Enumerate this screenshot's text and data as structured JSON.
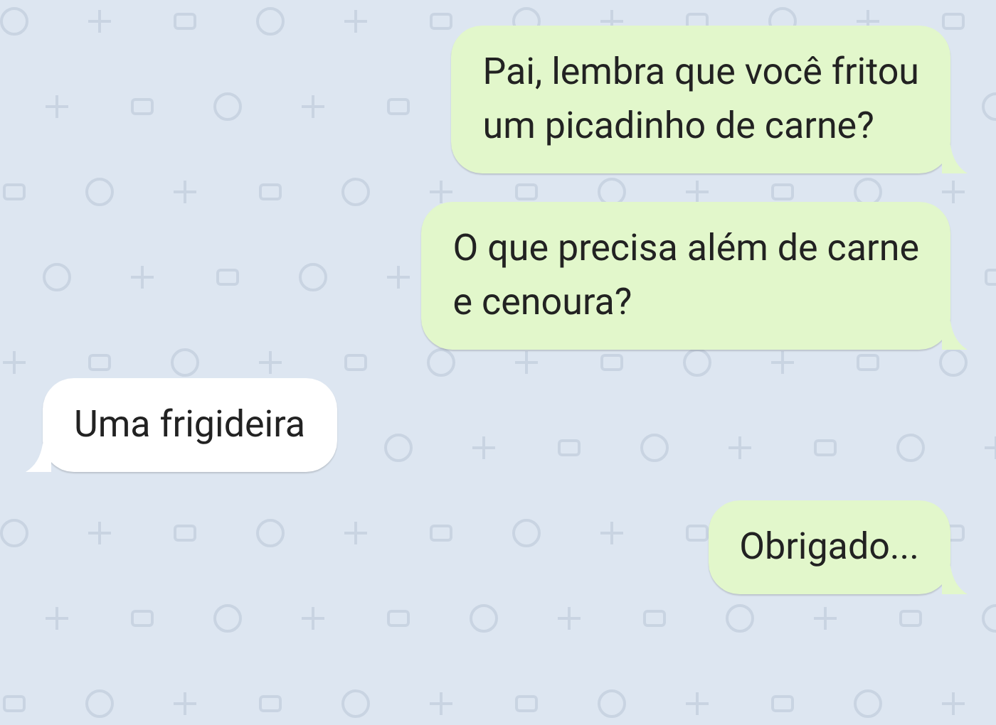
{
  "messages": [
    {
      "kind": "sent",
      "text": "Pai, lembra que você fritou\num picadinho de carne?"
    },
    {
      "kind": "sent",
      "text": "O que precisa além de carne\ne cenoura?"
    },
    {
      "kind": "received",
      "text": "Uma frigideira"
    },
    {
      "kind": "sent",
      "text": "Obrigado..."
    }
  ]
}
